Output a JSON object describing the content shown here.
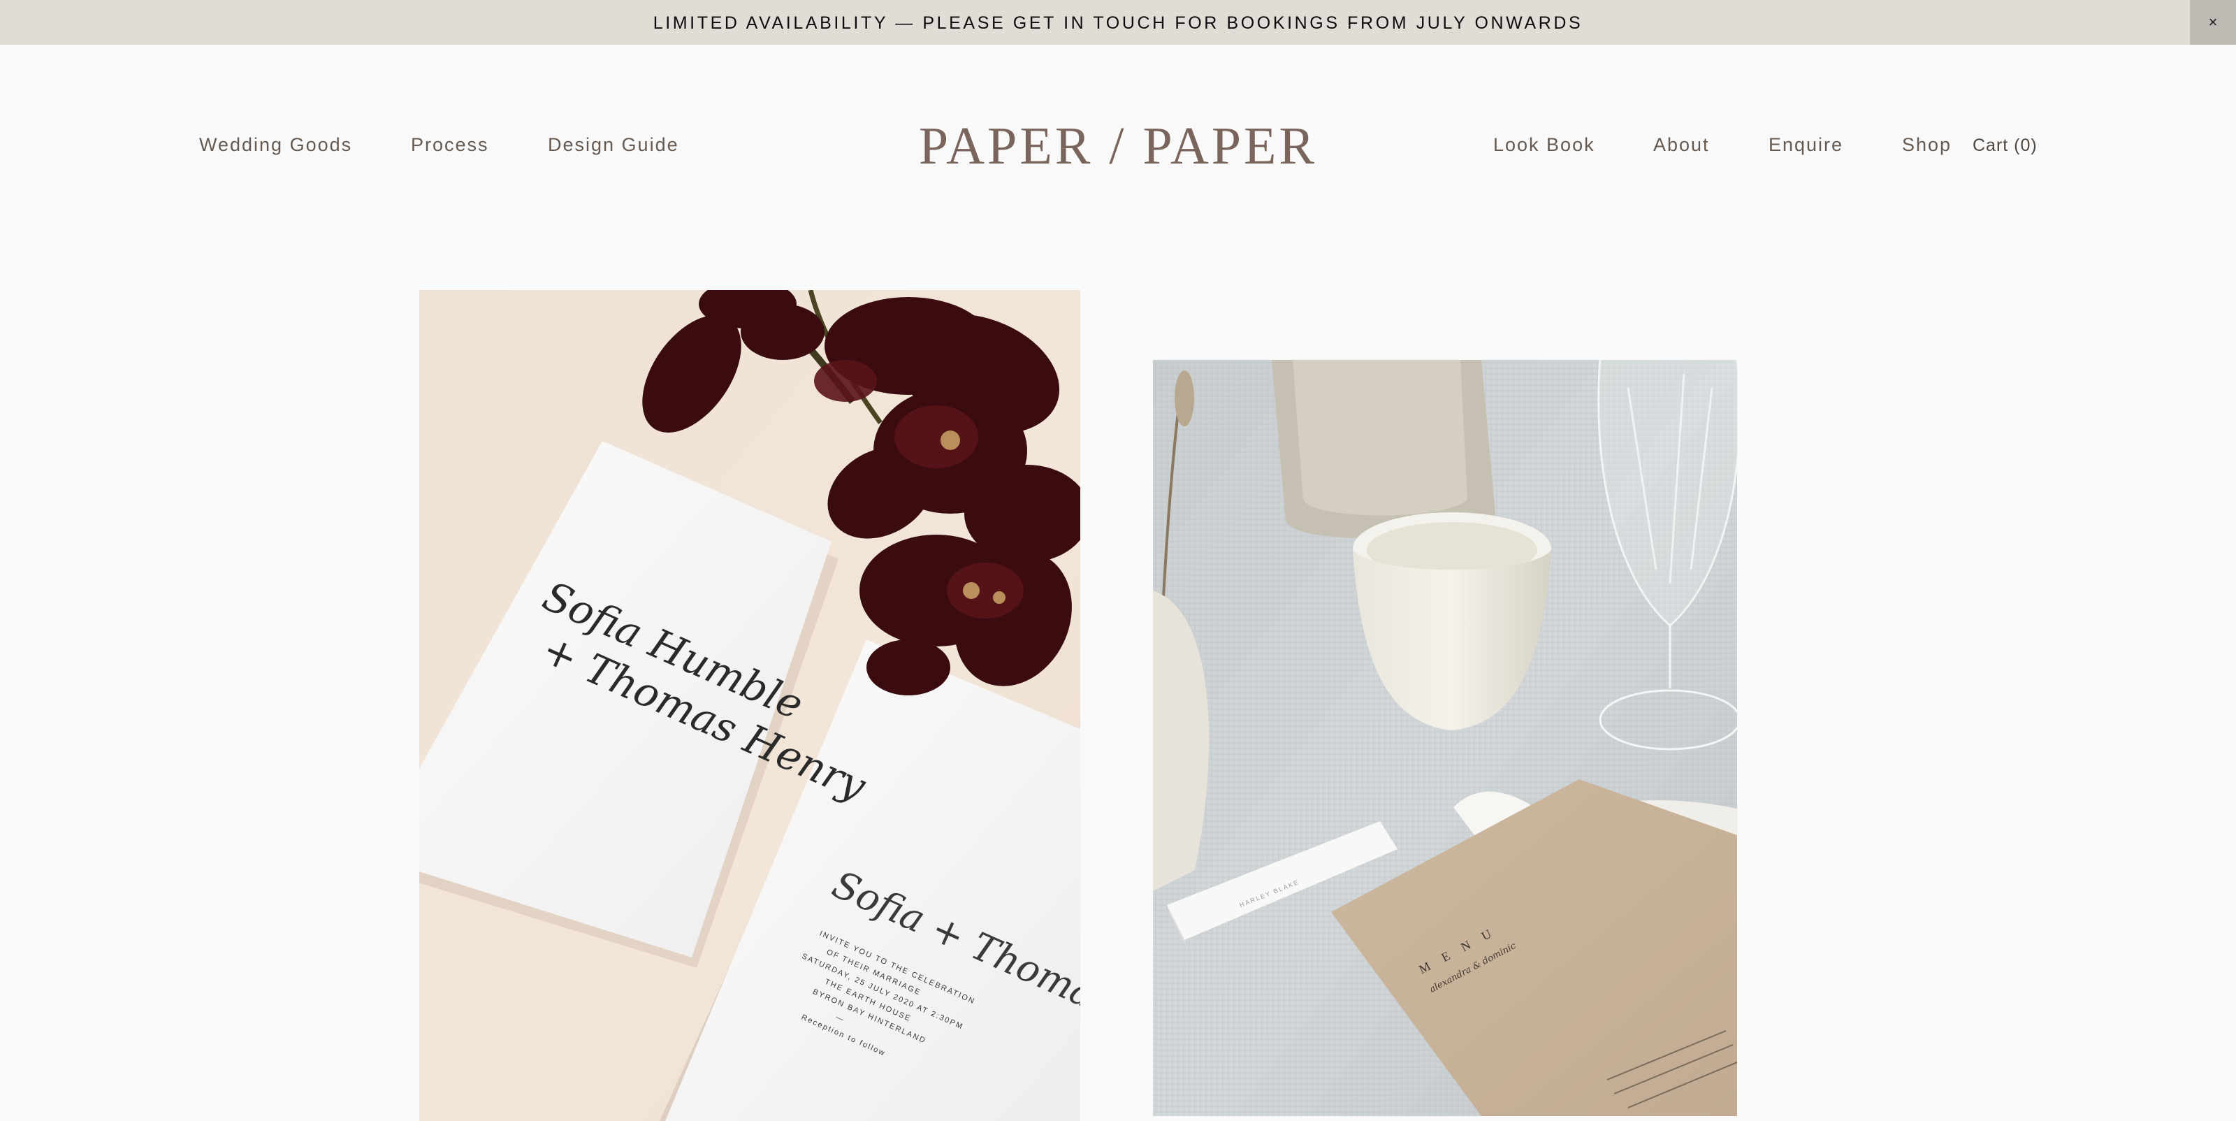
{
  "announcement": {
    "text": "LIMITED AVAILABILITY — PLEASE GET IN TOUCH FOR BOOKINGS FROM JULY ONWARDS",
    "close_icon": "close-icon",
    "close_glyph": "×"
  },
  "header": {
    "logo": "PAPER / PAPER",
    "nav_left": [
      "Wedding Goods",
      "Process",
      "Design Guide"
    ],
    "nav_right": [
      "Look Book",
      "About",
      "Enquire",
      "Shop"
    ],
    "cart_label": "Cart (0)"
  },
  "gallery": {
    "left_image": {
      "card1_script_line1": "Sofia Humble",
      "card1_script_line2": "+ Thomas Henry",
      "card2_script": "Sofia + Thomas",
      "card2_lines": [
        "INVITE YOU TO THE CELEBRATION",
        "OF THEIR MARRIAGE",
        "SATURDAY, 25 JULY 2020 AT 2:30PM",
        "THE EARTH HOUSE",
        "BYRON BAY HINTERLAND",
        "—",
        "Reception to follow"
      ]
    },
    "right_image": {
      "menu_title": "M E N U",
      "menu_names": "alexandra & dominic",
      "place_card_text": "HARLEY BLAKE"
    }
  },
  "colors": {
    "background": "#f9f9f9",
    "announcement_bg": "#e2dcd6",
    "announcement_close_bg": "#bfb9b3",
    "nav_text": "#655a52",
    "logo": "#7a655c"
  }
}
